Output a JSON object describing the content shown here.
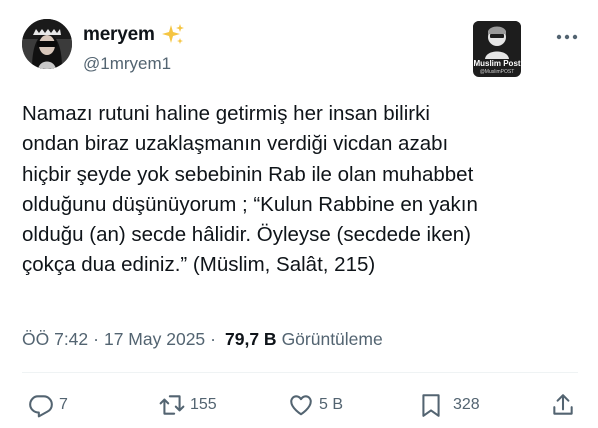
{
  "author": {
    "display_name": "meryem",
    "handle": "@1mryem1",
    "emoji": "sparkles-icon"
  },
  "badge": {
    "title": "Muslim Post",
    "subtitle": "@MuslimPOST"
  },
  "tweet": {
    "text": "Namazı rutuni haline getirmiş her insan bilirki\nondan biraz uzaklaşmanın verdiği vicdan azabı\nhiçbir şeyde yok sebebinin Rab ile olan muhabbet\nolduğunu düşünüyorum ; “Kulun Rabbine en yakın\nolduğu (an) secde hâlidir. Öyleyse (secdede iken)\nçokça dua ediniz.” (Müslim, Salât, 215)"
  },
  "meta": {
    "time": "ÖÖ 7:42",
    "separator": "·",
    "date": "17 May 2025",
    "views": "79,7 B",
    "views_label": "Görüntüleme"
  },
  "actions": {
    "replies": "7",
    "reposts": "155",
    "likes": "5 B",
    "bookmarks": "328"
  },
  "colors": {
    "text": "#0f1419",
    "secondary": "#536471",
    "divider": "#eff3f4",
    "sparkle": "#f5c542"
  }
}
